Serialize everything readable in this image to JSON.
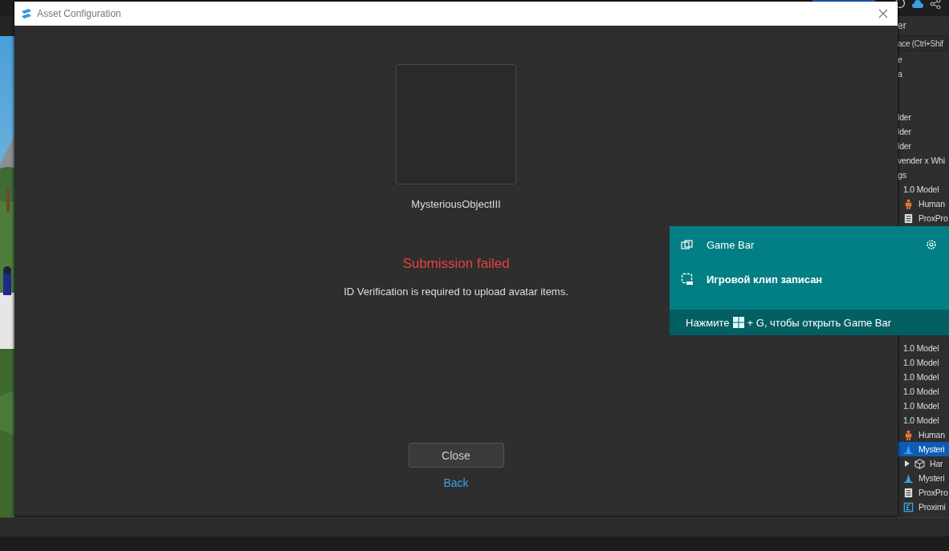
{
  "explorer": {
    "header": "er",
    "search": {
      "placeholder": "ace (Ctrl+Shif"
    },
    "sections": [
      {
        "rows": [
          {
            "label": "e",
            "kind": "text",
            "selected": false
          },
          {
            "label": "a",
            "kind": "text",
            "selected": false
          }
        ]
      },
      {
        "rows": [
          {
            "label": "lder",
            "kind": "text",
            "selected": false
          },
          {
            "label": "lder",
            "kind": "text",
            "selected": false
          },
          {
            "label": "lder",
            "kind": "text",
            "selected": false
          },
          {
            "label": "vender x Whi",
            "kind": "text",
            "selected": false
          },
          {
            "label": "gs",
            "kind": "text",
            "selected": false,
            "children": [
              {
                "label": "1.0 Model",
                "kind": "text",
                "selected": false
              },
              {
                "label": "Human",
                "kind": "humanoid",
                "selected": false
              },
              {
                "label": "ProxPro",
                "kind": "script",
                "selected": false
              }
            ]
          }
        ]
      },
      {
        "rows": [
          {
            "label": "1.0 Model",
            "kind": "text",
            "selected": false
          },
          {
            "label": "1.0 Model",
            "kind": "text",
            "selected": false
          },
          {
            "label": "1.0 Model",
            "kind": "text",
            "selected": false
          },
          {
            "label": "1.0 Model",
            "kind": "text",
            "selected": false
          },
          {
            "label": "1.0 Model",
            "kind": "text",
            "selected": false
          },
          {
            "label": "1.0 Model",
            "kind": "text",
            "selected": false
          },
          {
            "label": "Human",
            "kind": "humanoid",
            "selected": false
          },
          {
            "label": "Mysteri",
            "kind": "tool",
            "selected": true,
            "children": [
              {
                "label": "Har",
                "kind": "part",
                "selected": false,
                "expanded": false
              }
            ]
          },
          {
            "label": "Mysteri",
            "kind": "tool",
            "selected": false
          },
          {
            "label": "ProxPro",
            "kind": "script",
            "selected": false
          },
          {
            "label": "Proximi",
            "kind": "prompt",
            "selected": false
          }
        ]
      }
    ]
  },
  "dialog": {
    "title": "Asset Configuration",
    "asset_name": "MysteriousObjectIII",
    "status": "Submission failed",
    "message": "ID Verification is required to upload avatar items.",
    "close_button": "Close",
    "back_link": "Back"
  },
  "game_bar": {
    "title": "Game Bar",
    "notification": "Игровой клип записан",
    "hint_before": "Нажмите",
    "hint_after": "+ G, чтобы открыть Game Bar"
  }
}
